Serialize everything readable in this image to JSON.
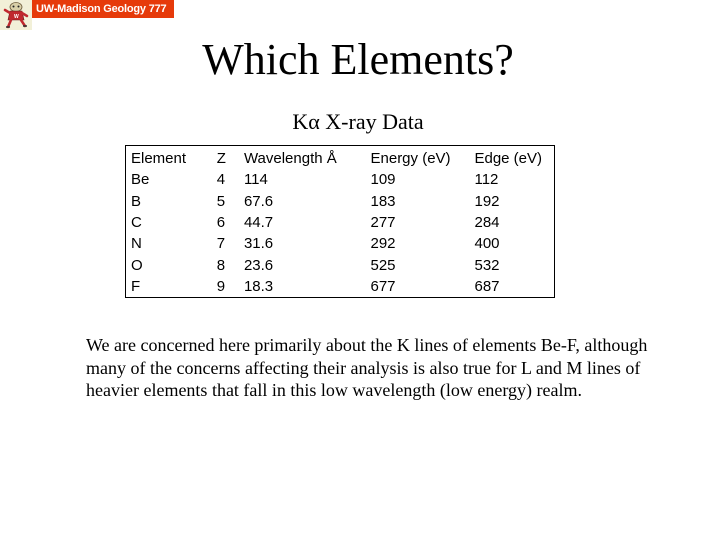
{
  "header": {
    "banner_text": "UW-Madison Geology  777",
    "logo_icon": "badger-mascot-icon",
    "brand_color": "#e63a0a"
  },
  "slide": {
    "title": "Which Elements?",
    "subtitle": "Kα X-ray Data"
  },
  "table": {
    "columns": [
      "Element",
      "Z",
      "Wavelength Å",
      "Energy (eV)",
      "Edge (eV)"
    ],
    "rows": [
      [
        "Be",
        "4",
        "114",
        "109",
        "112"
      ],
      [
        "B",
        "5",
        "67.6",
        "183",
        "192"
      ],
      [
        "C",
        "6",
        "44.7",
        "277",
        "284"
      ],
      [
        "N",
        "7",
        "31.6",
        "292",
        "400"
      ],
      [
        "O",
        "8",
        "23.6",
        "525",
        "532"
      ],
      [
        "F",
        "9",
        "18.3",
        "677",
        "687"
      ]
    ]
  },
  "body": {
    "paragraph": "We are concerned here primarily about the K lines of elements Be-F, although many of the concerns affecting their analysis is also true for L and M lines of heavier elements that fall in this low wavelength (low energy) realm."
  }
}
